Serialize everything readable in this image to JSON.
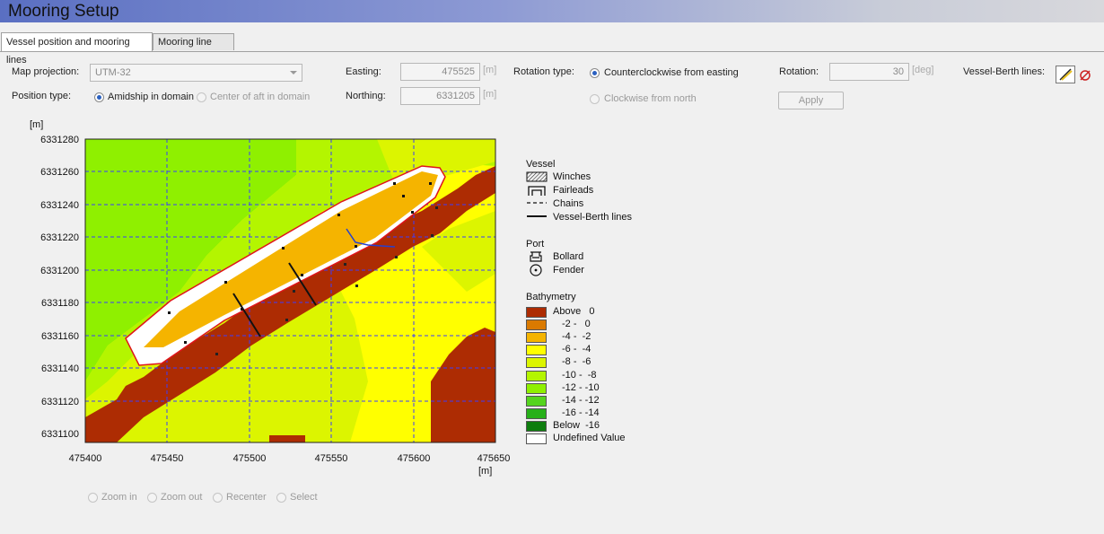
{
  "window": {
    "title": "Mooring Setup"
  },
  "tabs": [
    {
      "label": "Vessel position and mooring lines",
      "active": true
    },
    {
      "label": "Mooring line data",
      "active": false
    }
  ],
  "form": {
    "map_projection": {
      "label": "Map  projection:",
      "value": "UTM-32"
    },
    "position_type": {
      "label": "Position type:",
      "options": [
        {
          "label": "Amidship in domain",
          "selected": true
        },
        {
          "label": "Center of aft in domain",
          "selected": false
        }
      ]
    },
    "easting": {
      "label": "Easting:",
      "value": "475525",
      "unit": "[m]"
    },
    "northing": {
      "label": "Northing:",
      "value": "6331205",
      "unit": "[m]"
    },
    "rotation_type": {
      "label": "Rotation type:",
      "options": [
        {
          "label": "Counterclockwise from easting",
          "selected": true
        },
        {
          "label": "Clockwise from north",
          "selected": false
        }
      ]
    },
    "rotation": {
      "label": "Rotation:",
      "value": "30",
      "unit": "[deg]"
    },
    "apply_label": "Apply",
    "vessel_berth_lines_label": "Vessel-Berth lines:"
  },
  "map_tools": [
    {
      "label": "Zoom in"
    },
    {
      "label": "Zoom out"
    },
    {
      "label": "Recenter"
    },
    {
      "label": "Select"
    }
  ],
  "legend": {
    "vessel_heading": "Vessel",
    "vessel_items": [
      "Winches",
      "Fairleads",
      "Chains",
      "Vessel-Berth lines"
    ],
    "port_heading": "Port",
    "port_items": [
      "Bollard",
      "Fender"
    ],
    "bathy_heading": "Bathymetry",
    "bathy_items": [
      {
        "label": "Above   0",
        "color": "#ad2c03"
      },
      {
        "label": "-2 -   0",
        "color": "#da7a00"
      },
      {
        "label": "-4 -  -2",
        "color": "#f5b400"
      },
      {
        "label": "-6 -  -4",
        "color": "#ffff00"
      },
      {
        "label": "-8 -  -6",
        "color": "#dcf500"
      },
      {
        "label": "-10 -  -8",
        "color": "#b4f500"
      },
      {
        "label": "-12 - -10",
        "color": "#8ff000"
      },
      {
        "label": "-14 - -12",
        "color": "#55d41e"
      },
      {
        "label": "-16 - -14",
        "color": "#27b019"
      },
      {
        "label": "Below  -16",
        "color": "#0e7d0e"
      },
      {
        "label": "Undefined Value",
        "color": "#ffffff"
      }
    ]
  },
  "chart_data": {
    "type": "heatmap",
    "xlabel": "[m]",
    "ylabel": "[m]",
    "xlim": [
      475400,
      475650
    ],
    "ylim": [
      6331095,
      6331280
    ],
    "x_ticks": [
      "475400",
      "475450",
      "475500",
      "475550",
      "475600",
      "475650"
    ],
    "y_ticks": [
      "6331280",
      "6331260",
      "6331240",
      "6331220",
      "6331200",
      "6331180",
      "6331160",
      "6331140",
      "6331120",
      "6331100"
    ],
    "grid": true,
    "vessel_center": [
      475525,
      6331205
    ],
    "vessel_rotation_deg": 30
  }
}
